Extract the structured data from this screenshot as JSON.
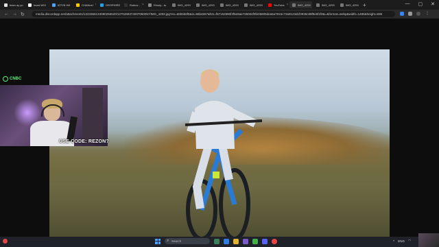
{
  "browser": {
    "tabs": [
      {
        "label": "team ay yo",
        "active": false
      },
      {
        "label": "heart WSI",
        "active": false
      },
      {
        "label": "ЮТУБ НИ",
        "active": false
      },
      {
        "label": "CHANnel",
        "active": false
      },
      {
        "label": "DROPHIRE",
        "active": false
      },
      {
        "label": "Roblox -",
        "active": false
      },
      {
        "label": "Ebody - tu",
        "active": false
      },
      {
        "label": "IMG_4293",
        "active": false
      },
      {
        "label": "IMG_4293",
        "active": false
      },
      {
        "label": "IMG_4293",
        "active": false
      },
      {
        "label": "IMG_4293",
        "active": false
      },
      {
        "label": "YouTube",
        "active": false
      },
      {
        "label": "IMG_4293",
        "active": true
      },
      {
        "label": "IMG_4293",
        "active": false
      },
      {
        "label": "IMG_4293",
        "active": false
      }
    ],
    "url": "media.discordapp.net/attachments/1223365133080255520/1270469374007050057/IMG_4293.jpg?ex=66b5b6f9&is=66b4657&hm=f67152890f4f5e9ae735004f0fe05805dea6a7815c73a9123d1f3935c89f9e5f1f8&=&format=webp&width=1486&height=838",
    "new_tab": "+",
    "window_controls": [
      "—",
      "▢",
      "✕"
    ]
  },
  "stream": {
    "logo_text": "CNBC",
    "promo_text": "USE CODE: REZON?"
  },
  "taskbar": {
    "search_placeholder": "Search",
    "language": "ENG",
    "time": "",
    "date": ""
  },
  "colors": {
    "accent_green": "#5ef07a",
    "taskbar_bg": "#1f2329",
    "browser_bg": "#1c1c1c"
  }
}
